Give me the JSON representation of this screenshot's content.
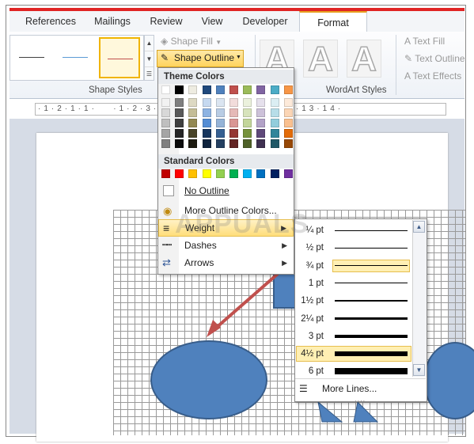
{
  "ribbon": {
    "tabs": [
      {
        "label": "References"
      },
      {
        "label": "Mailings"
      },
      {
        "label": "Review"
      },
      {
        "label": "View"
      },
      {
        "label": "Developer"
      },
      {
        "label": "Format"
      }
    ],
    "shape_fill": "Shape Fill",
    "shape_outline": "Shape Outline",
    "shape_styles_label": "Shape Styles",
    "wordart_styles_label": "WordArt Styles",
    "text_fill": "Text Fill",
    "text_outline": "Text Outline",
    "text_effects": "Text Effects",
    "wordart_letter": "A",
    "gallery_colors": [
      "#404040",
      "#5b9bd5",
      "#c0504d"
    ]
  },
  "menu": {
    "theme_colors_header": "Theme Colors",
    "standard_colors_header": "Standard Colors",
    "no_outline": "No Outline",
    "more_outline_colors": "More Outline Colors...",
    "weight": "Weight",
    "dashes": "Dashes",
    "arrows": "Arrows",
    "theme_top_row": [
      "#ffffff",
      "#000000",
      "#eeece1",
      "#1f497d",
      "#4f81bd",
      "#c0504d",
      "#9bbb59",
      "#8064a2",
      "#4bacc6",
      "#f79646"
    ],
    "theme_shades": [
      [
        "#f2f2f2",
        "#7f7f7f",
        "#ddd9c3",
        "#c6d9f0",
        "#dbe5f1",
        "#f2dcdb",
        "#ebf1dd",
        "#e5e0ec",
        "#dbeef3",
        "#fdeada"
      ],
      [
        "#d8d8d8",
        "#595959",
        "#c4bd97",
        "#8db3e2",
        "#b8cce4",
        "#e5b9b7",
        "#d7e3bc",
        "#ccc1d9",
        "#b7dde8",
        "#fbd5b5"
      ],
      [
        "#bfbfbf",
        "#3f3f3f",
        "#938953",
        "#548dd4",
        "#95b3d7",
        "#d99694",
        "#c3d69b",
        "#b2a2c7",
        "#92cddc",
        "#fac08f"
      ],
      [
        "#a5a5a5",
        "#262626",
        "#494429",
        "#17365d",
        "#366092",
        "#953734",
        "#76923c",
        "#5f497a",
        "#31859b",
        "#e36c09"
      ],
      [
        "#7f7f7f",
        "#0c0c0c",
        "#1d1b10",
        "#0f243e",
        "#244061",
        "#632423",
        "#4f6128",
        "#3f3151",
        "#205867",
        "#974806"
      ]
    ],
    "standard": [
      "#c00000",
      "#ff0000",
      "#ffc000",
      "#ffff00",
      "#92d050",
      "#00b050",
      "#00b0f0",
      "#0070c0",
      "#002060",
      "#7030a0"
    ]
  },
  "weights": [
    {
      "label": "¼ pt",
      "w": 0.25
    },
    {
      "label": "½ pt",
      "w": 0.5
    },
    {
      "label": "¾ pt",
      "w": 0.75,
      "selected": true
    },
    {
      "label": "1 pt",
      "w": 1
    },
    {
      "label": "1½ pt",
      "w": 1.5
    },
    {
      "label": "2¼ pt",
      "w": 2.25
    },
    {
      "label": "3 pt",
      "w": 3
    },
    {
      "label": "4½ pt",
      "w": 4.5
    },
    {
      "label": "6 pt",
      "w": 6
    }
  ],
  "more_lines": "More Lines...",
  "watermark": "APPUALS"
}
